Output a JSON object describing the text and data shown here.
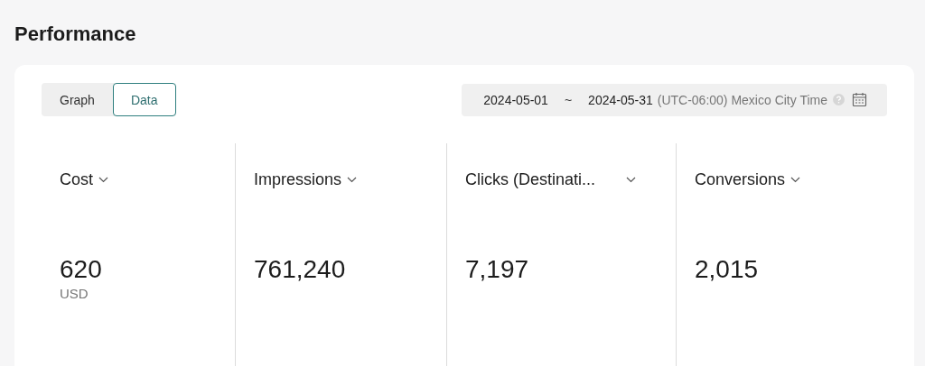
{
  "title": "Performance",
  "view_tabs": [
    {
      "label": "Graph",
      "selected": false
    },
    {
      "label": "Data",
      "selected": true
    }
  ],
  "date_range": {
    "start": "2024-05-01",
    "separator": "~",
    "end": "2024-05-31",
    "timezone": "(UTC-06:00) Mexico City Time"
  },
  "metrics": [
    {
      "label": "Cost",
      "value": "620",
      "unit": "USD"
    },
    {
      "label": "Impressions",
      "value": "761,240"
    },
    {
      "label": "Clicks (Destinati...",
      "value": "7,197"
    },
    {
      "label": "Conversions",
      "value": "2,015"
    }
  ]
}
